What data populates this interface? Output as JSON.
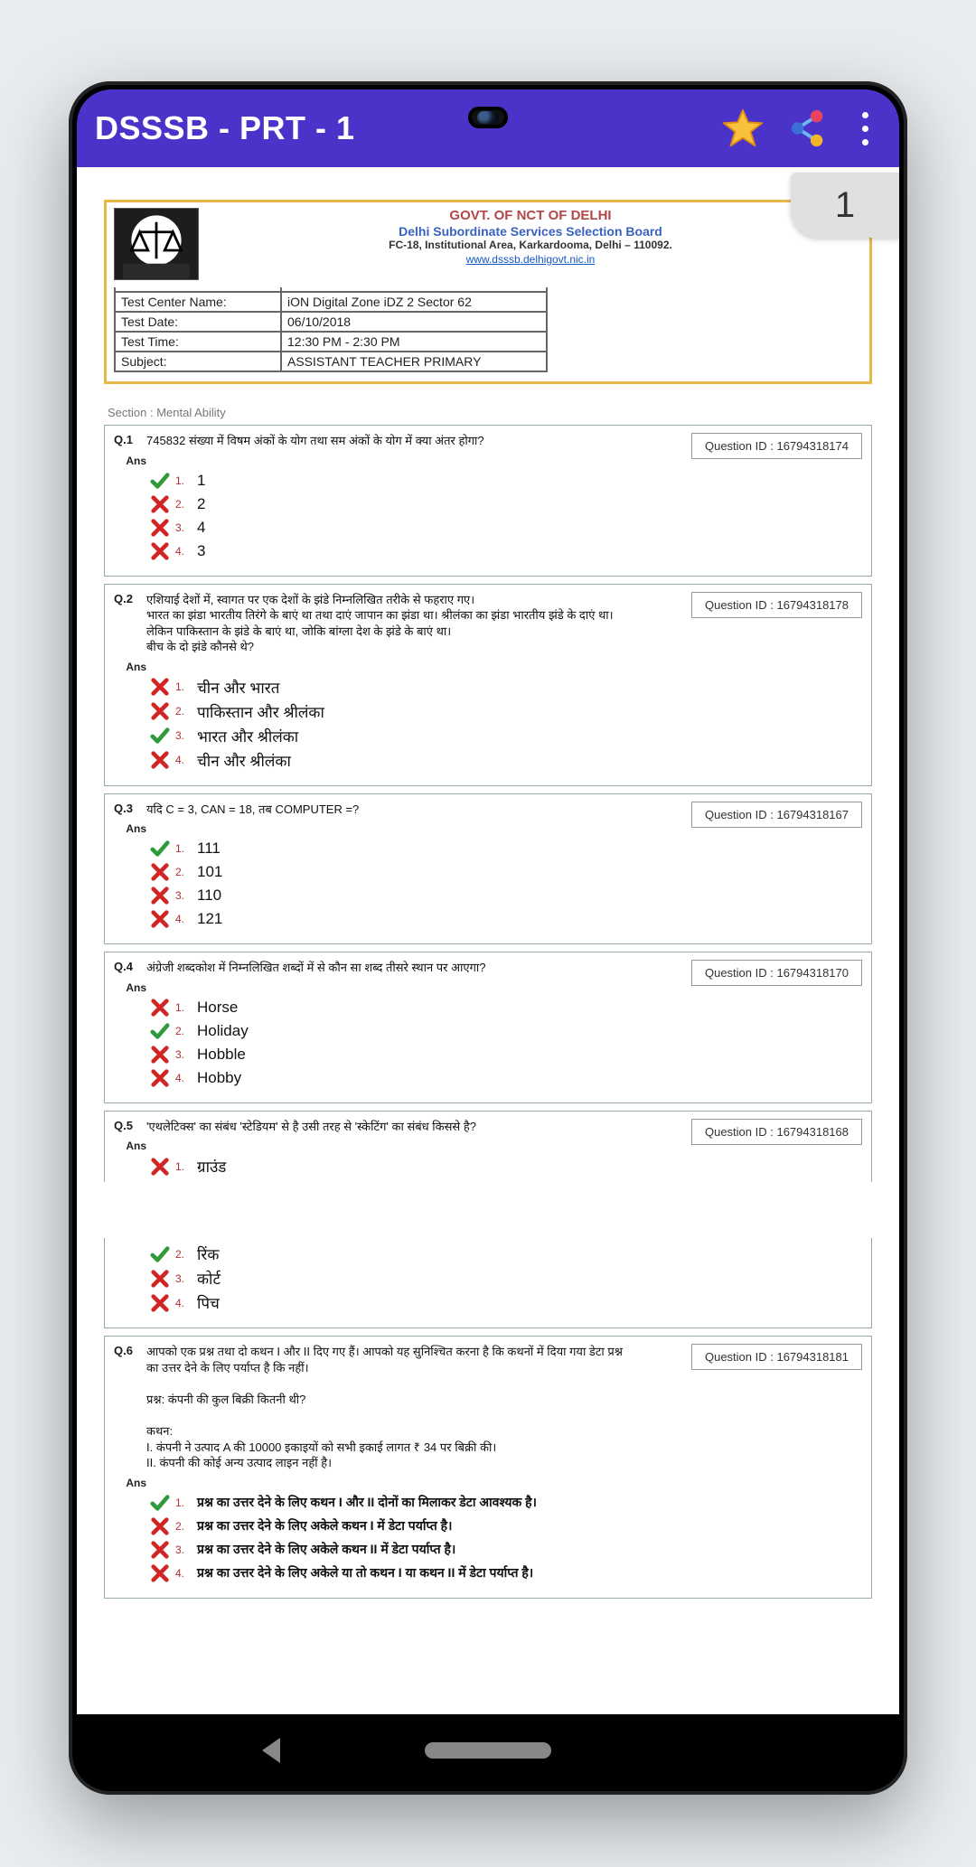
{
  "appbar": {
    "title": "DSSSB - PRT - 1"
  },
  "page_badge": "1",
  "doc_header": {
    "line1": "GOVT. OF NCT OF DELHI",
    "line2": "Delhi Subordinate Services Selection Board",
    "line3": "FC-18, Institutional Area, Karkardooma, Delhi – 110092.",
    "link": "www.dsssb.delhigovt.nic.in"
  },
  "info_rows": [
    {
      "label": "Test Center Name:",
      "value": "iON Digital Zone iDZ 2 Sector 62"
    },
    {
      "label": "Test Date:",
      "value": "06/10/2018"
    },
    {
      "label": "Test Time:",
      "value": "12:30 PM - 2:30 PM"
    },
    {
      "label": "Subject:",
      "value": "ASSISTANT TEACHER PRIMARY"
    }
  ],
  "section_label": "Section : Mental Ability",
  "qid_prefix": "Question ID : ",
  "ans_label": "Ans",
  "questions": [
    {
      "num": "Q.1",
      "qid": "16794318174",
      "text": "745832 संख्या में विषम अंकों के योग तथा सम अंकों के योग में क्या अंतर होगा?",
      "options": [
        {
          "c": true,
          "n": "1.",
          "t": "1"
        },
        {
          "c": false,
          "n": "2.",
          "t": "2"
        },
        {
          "c": false,
          "n": "3.",
          "t": "4"
        },
        {
          "c": false,
          "n": "4.",
          "t": "3"
        }
      ]
    },
    {
      "num": "Q.2",
      "qid": "16794318178",
      "text": "एशियाई देशों में, स्वागत पर एक देशों के झंडे निम्नलिखित तरीके से फहराए गए।\nभारत का झंडा भारतीय तिरंगे के बाएं था तथा दाएं जापान का झंडा था। श्रीलंका का झंडा भारतीय झंडे के दाएं था।\nलेकिन पाकिस्तान के झंडे के बाएं था, जोकि बांग्ला देश के झंडे के बाएं था।\nबीच के दो झंडे कौनसे थे?",
      "options": [
        {
          "c": false,
          "n": "1.",
          "t": "चीन और भारत"
        },
        {
          "c": false,
          "n": "2.",
          "t": "पाकिस्तान और श्रीलंका"
        },
        {
          "c": true,
          "n": "3.",
          "t": "भारत और श्रीलंका"
        },
        {
          "c": false,
          "n": "4.",
          "t": "चीन और श्रीलंका"
        }
      ]
    },
    {
      "num": "Q.3",
      "qid": "16794318167",
      "text": "यदि C = 3, CAN = 18, तब COMPUTER =?",
      "options": [
        {
          "c": true,
          "n": "1.",
          "t": "111"
        },
        {
          "c": false,
          "n": "2.",
          "t": "101"
        },
        {
          "c": false,
          "n": "3.",
          "t": "110"
        },
        {
          "c": false,
          "n": "4.",
          "t": "121"
        }
      ]
    },
    {
      "num": "Q.4",
      "qid": "16794318170",
      "text": "अंग्रेजी शब्दकोश में निम्नलिखित शब्दों में से कौन सा शब्द तीसरे स्थान पर आएगा?",
      "options": [
        {
          "c": false,
          "n": "1.",
          "t": "Horse"
        },
        {
          "c": true,
          "n": "2.",
          "t": "Holiday"
        },
        {
          "c": false,
          "n": "3.",
          "t": "Hobble"
        },
        {
          "c": false,
          "n": "4.",
          "t": "Hobby"
        }
      ]
    },
    {
      "num": "Q.5",
      "qid": "16794318168",
      "text": "'एथलेटिक्स' का संबंध 'स्टेडियम' से है उसी तरह से 'स्केटिंग' का संबंध किससे है?",
      "options": [
        {
          "c": false,
          "n": "1.",
          "t": "ग्राउंड"
        },
        {
          "c": true,
          "n": "2.",
          "t": "रिंक"
        },
        {
          "c": false,
          "n": "3.",
          "t": "कोर्ट"
        },
        {
          "c": false,
          "n": "4.",
          "t": "पिच"
        }
      ],
      "split_after": 0
    },
    {
      "num": "Q.6",
      "qid": "16794318181",
      "text": "आपको एक प्रश्न तथा दो कथन I और II दिए गए हैं। आपको यह सुनिश्चित करना है कि कथनों में दिया गया डेटा प्रश्न का उत्तर देने के लिए पर्याप्त है कि नहीं।\n\nप्रश्न: कंपनी की कुल बिक्री कितनी थी?\n\nकथन:\nI. कंपनी ने उत्पाद A की 10000 इकाइयों को सभी इकाई लागत ₹ 34 पर बिक्री की।\nII. कंपनी की कोई अन्य उत्पाद लाइन नहीं है।",
      "options": [
        {
          "c": true,
          "n": "1.",
          "t": "प्रश्न का उत्तर देने के लिए कथन I और II दोनों का मिलाकर डेटा आवश्यक है।"
        },
        {
          "c": false,
          "n": "2.",
          "t": "प्रश्न का उत्तर देने के लिए अकेले कथन I में डेटा पर्याप्त है।"
        },
        {
          "c": false,
          "n": "3.",
          "t": "प्रश्न का उत्तर देने के लिए अकेले कथन II में डेटा पर्याप्त है।"
        },
        {
          "c": false,
          "n": "4.",
          "t": "प्रश्न का उत्तर देने के लिए अकेले या तो कथन I या कथन II में डेटा पर्याप्त है।"
        }
      ]
    }
  ]
}
